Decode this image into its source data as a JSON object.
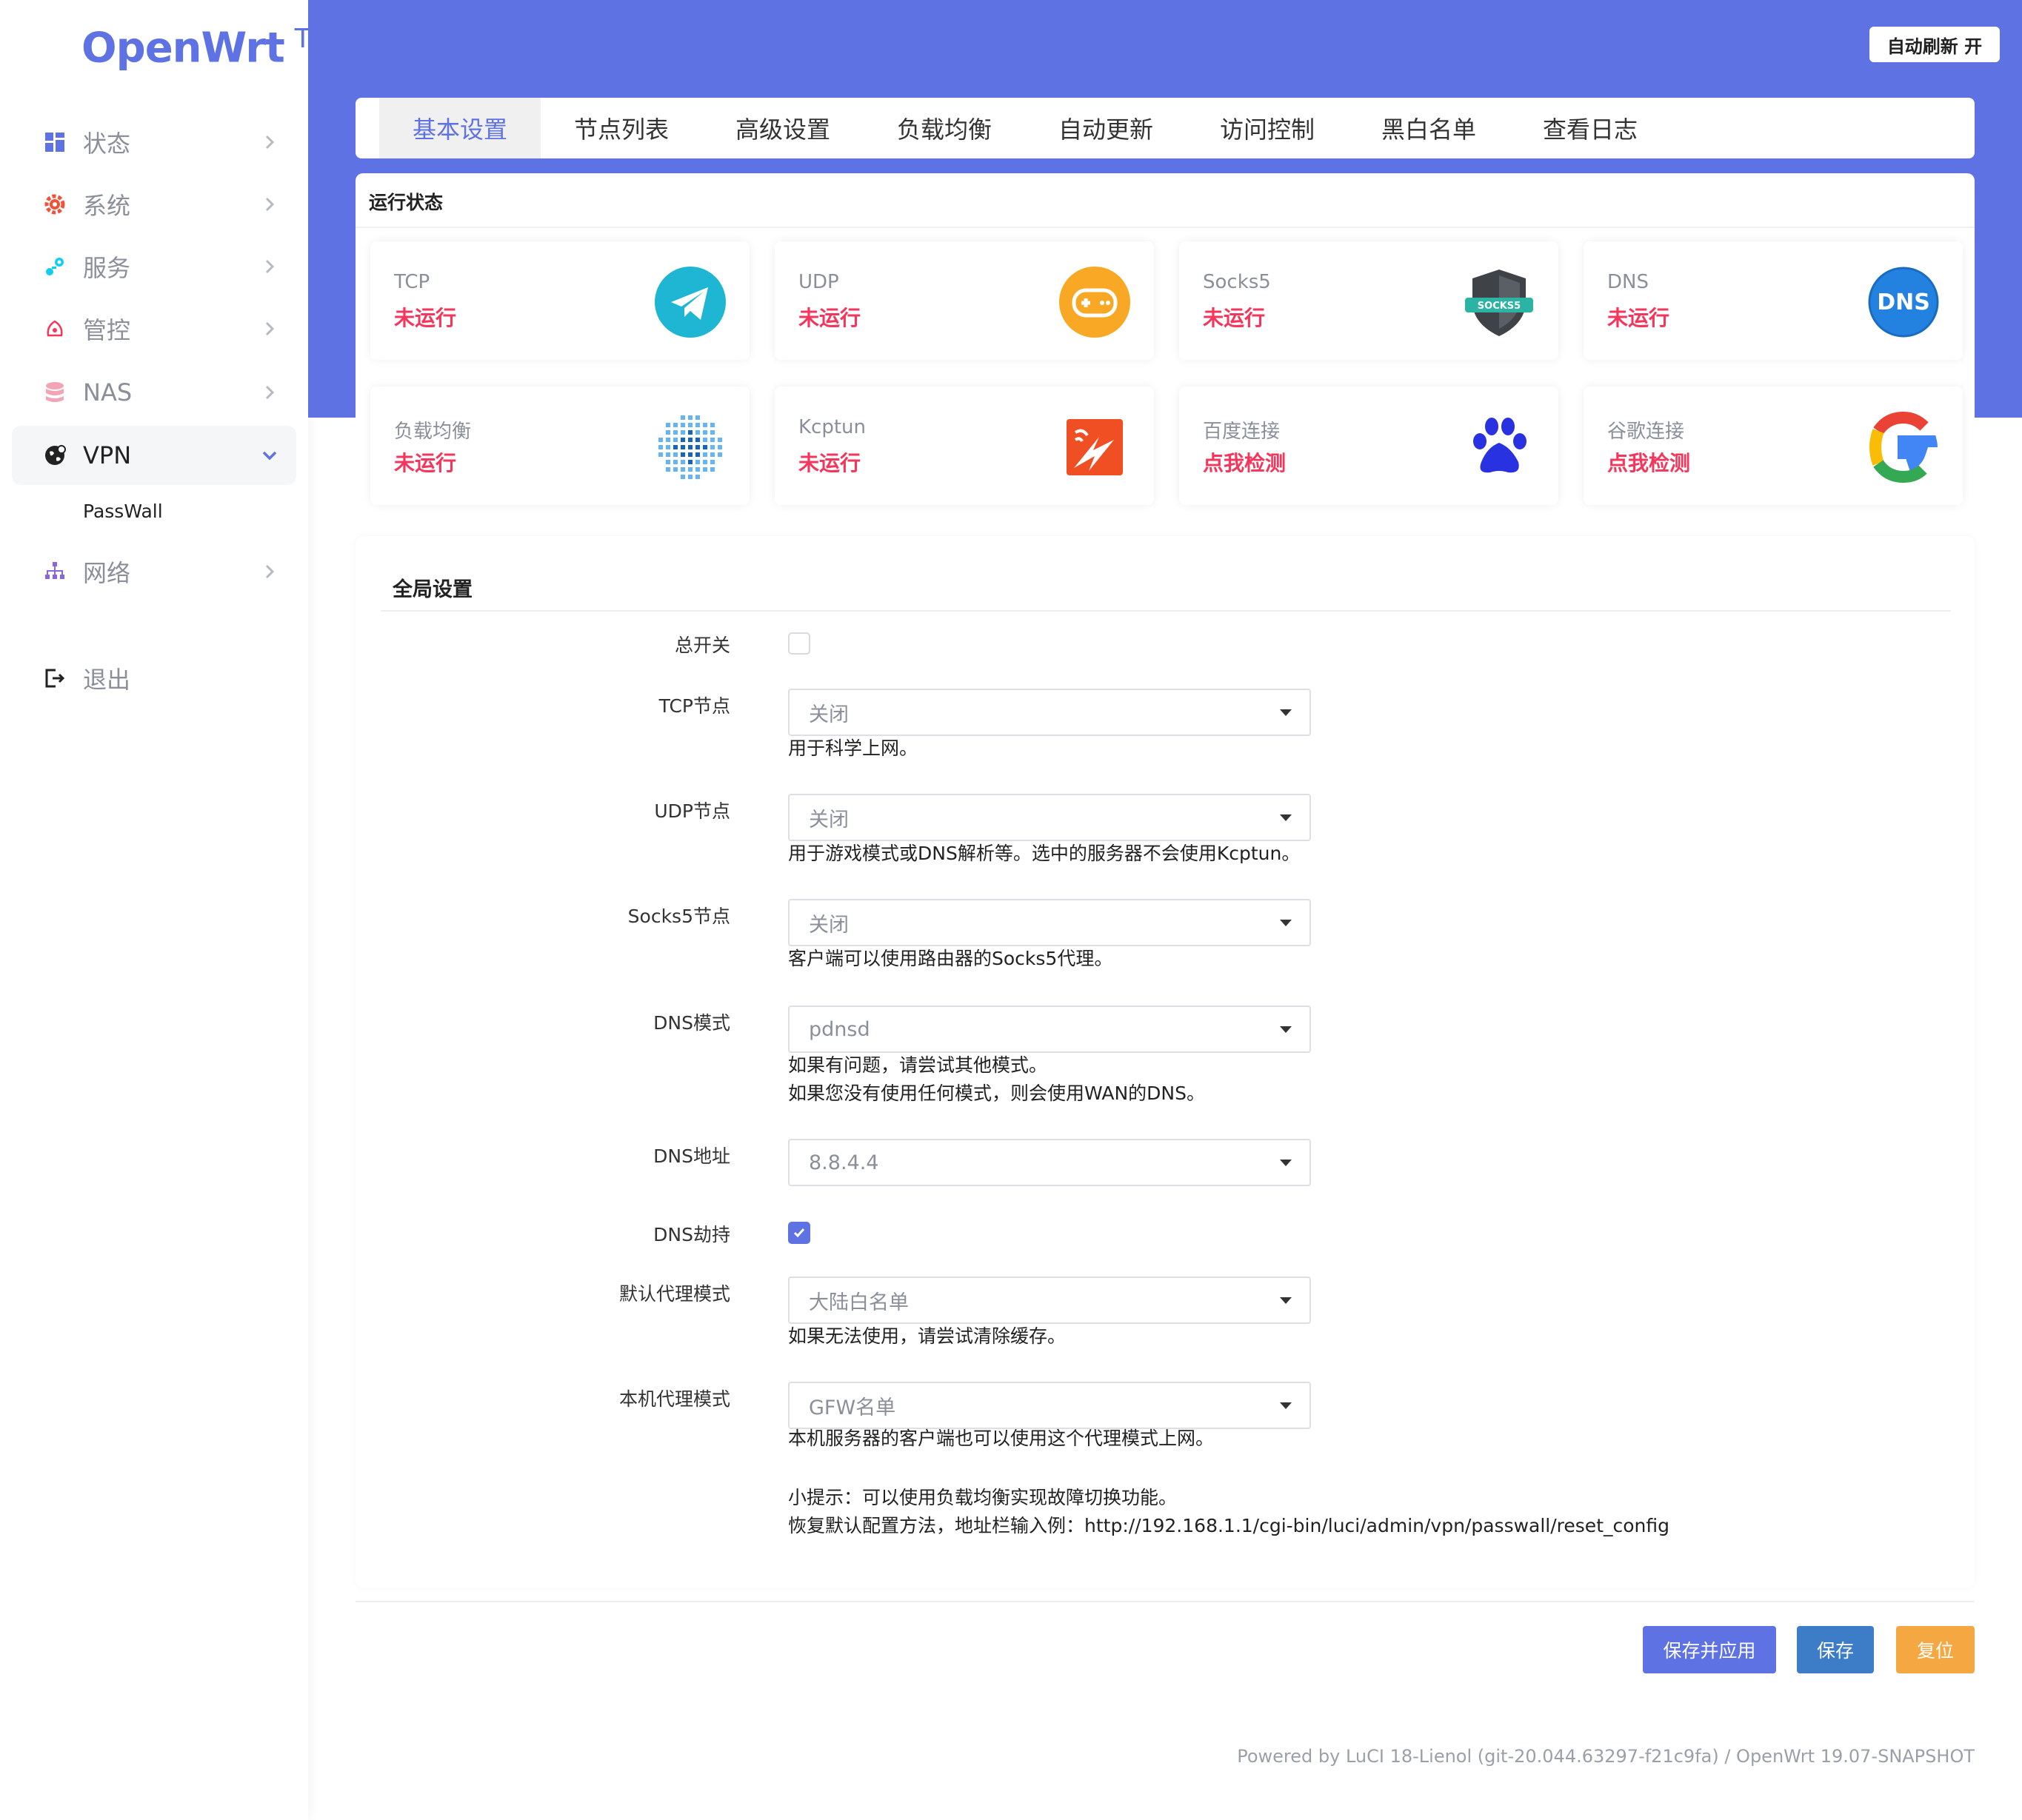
{
  "brand": {
    "name": "OpenWrt",
    "tm": "TM"
  },
  "sidebar": {
    "items": [
      {
        "label": "状态",
        "icon": "dashboard-icon"
      },
      {
        "label": "系统",
        "icon": "gear-icon"
      },
      {
        "label": "服务",
        "icon": "services-icon"
      },
      {
        "label": "管控",
        "icon": "control-icon"
      },
      {
        "label": "NAS",
        "icon": "database-icon"
      },
      {
        "label": "VPN",
        "icon": "globe-icon"
      },
      {
        "label": "网络",
        "icon": "network-icon"
      },
      {
        "label": "退出",
        "icon": "logout-icon"
      }
    ],
    "sub_item": "PassWall"
  },
  "header": {
    "refresh_label": "自动刷新 开"
  },
  "tabs": [
    "基本设置",
    "节点列表",
    "高级设置",
    "负载均衡",
    "自动更新",
    "访问控制",
    "黑白名单",
    "查看日志"
  ],
  "status": {
    "title": "运行状态",
    "cards": [
      {
        "name": "TCP",
        "state": "未运行",
        "icon": "telegram-plane-icon"
      },
      {
        "name": "UDP",
        "state": "未运行",
        "icon": "gamepad-icon"
      },
      {
        "name": "Socks5",
        "state": "未运行",
        "icon": "socks5-shield-icon"
      },
      {
        "name": "DNS",
        "state": "未运行",
        "icon": "dns-badge-icon"
      },
      {
        "name": "负载均衡",
        "state": "未运行",
        "icon": "load-balance-dots-icon"
      },
      {
        "name": "Kcptun",
        "state": "未运行",
        "icon": "kcptun-icon"
      },
      {
        "name": "百度连接",
        "state": "点我检测",
        "icon": "baidu-paw-icon"
      },
      {
        "name": "谷歌连接",
        "state": "点我检测",
        "icon": "google-g-icon"
      }
    ]
  },
  "global": {
    "title": "全局设置",
    "main_switch": {
      "label": "总开关",
      "checked": false
    },
    "tcp_node": {
      "label": "TCP节点",
      "value": "关闭",
      "hint": "用于科学上网。"
    },
    "udp_node": {
      "label": "UDP节点",
      "value": "关闭",
      "hint": "用于游戏模式或DNS解析等。选中的服务器不会使用Kcptun。"
    },
    "socks5_node": {
      "label": "Socks5节点",
      "value": "关闭",
      "hint": "客户端可以使用路由器的Socks5代理。"
    },
    "dns_mode": {
      "label": "DNS模式",
      "value": "pdnsd",
      "hint1": "如果有问题，请尝试其他模式。",
      "hint2": "如果您没有使用任何模式，则会使用WAN的DNS。"
    },
    "dns_addr": {
      "label": "DNS地址",
      "value": "8.8.4.4"
    },
    "dns_hijack": {
      "label": "DNS劫持",
      "checked": true
    },
    "default_proxy": {
      "label": "默认代理模式",
      "value": "大陆白名单",
      "hint": "如果无法使用，请尝试清除缓存。"
    },
    "local_proxy": {
      "label": "本机代理模式",
      "value": "GFW名单",
      "hint": "本机服务器的客户端也可以使用这个代理模式上网。"
    },
    "tip1": "小提示：可以使用负载均衡实现故障切换功能。",
    "tip2": "恢复默认配置方法，地址栏输入例：http://192.168.1.1/cgi-bin/luci/admin/vpn/passwall/reset_config"
  },
  "actions": {
    "apply": "保存并应用",
    "save": "保存",
    "reset": "复位"
  },
  "footer": "Powered by LuCI 18-Lienol (git-20.044.63297-f21c9fa) / OpenWrt 19.07-SNAPSHOT",
  "colors": {
    "accent": "#5e72e4",
    "danger": "#f5365c",
    "save": "#3d7dc8",
    "reset": "#f5a742"
  }
}
